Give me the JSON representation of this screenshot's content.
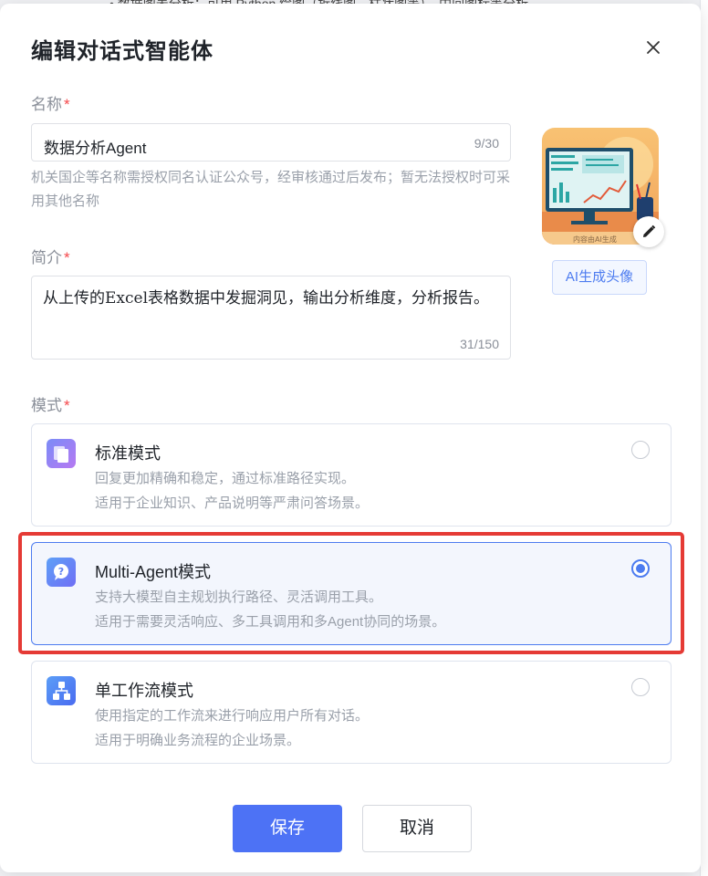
{
  "background": {
    "top_text": "• 数据图表分析：可用 Python 绘图（折线图、柱状图等），中间图标等分析"
  },
  "dialog": {
    "title": "编辑对话式智能体",
    "name_field": {
      "label": "名称",
      "required_mark": "*",
      "value": "数据分析Agent",
      "counter": "9/30"
    },
    "name_hint": "机关国企等名称需授权同名认证公众号，经审核通过后发布；暂无法授权时可采用其他名称",
    "intro_field": {
      "label": "简介",
      "required_mark": "*",
      "value": "从上传的Excel表格数据中发掘洞见，输出分析维度，分析报告。",
      "counter": "31/150"
    },
    "avatar": {
      "watermark": "内容由AI生成",
      "edit_icon": "pencil-icon"
    },
    "ai_avatar_button": "AI生成头像",
    "mode": {
      "label": "模式",
      "required_mark": "*",
      "options": [
        {
          "name": "标准模式",
          "desc1": "回复更加精确和稳定，通过标准路径实现。",
          "desc2": "适用于企业知识、产品说明等严肃问答场景。",
          "icon": "document-stack-icon",
          "selected": false
        },
        {
          "name": "Multi-Agent模式",
          "desc1": "支持大模型自主规划执行路径、灵活调用工具。",
          "desc2": "适用于需要灵活响应、多工具调用和多Agent协同的场景。",
          "icon": "question-bubble-icon",
          "selected": true
        },
        {
          "name": "单工作流模式",
          "desc1": "使用指定的工作流来进行响应用户所有对话。",
          "desc2": "适用于明确业务流程的企业场景。",
          "icon": "workflow-tree-icon",
          "selected": false
        }
      ]
    },
    "buttons": {
      "save": "保存",
      "cancel": "取消"
    },
    "colors": {
      "accent": "#4d72f5",
      "highlight": "#e53a35",
      "required": "#f5484b"
    }
  }
}
